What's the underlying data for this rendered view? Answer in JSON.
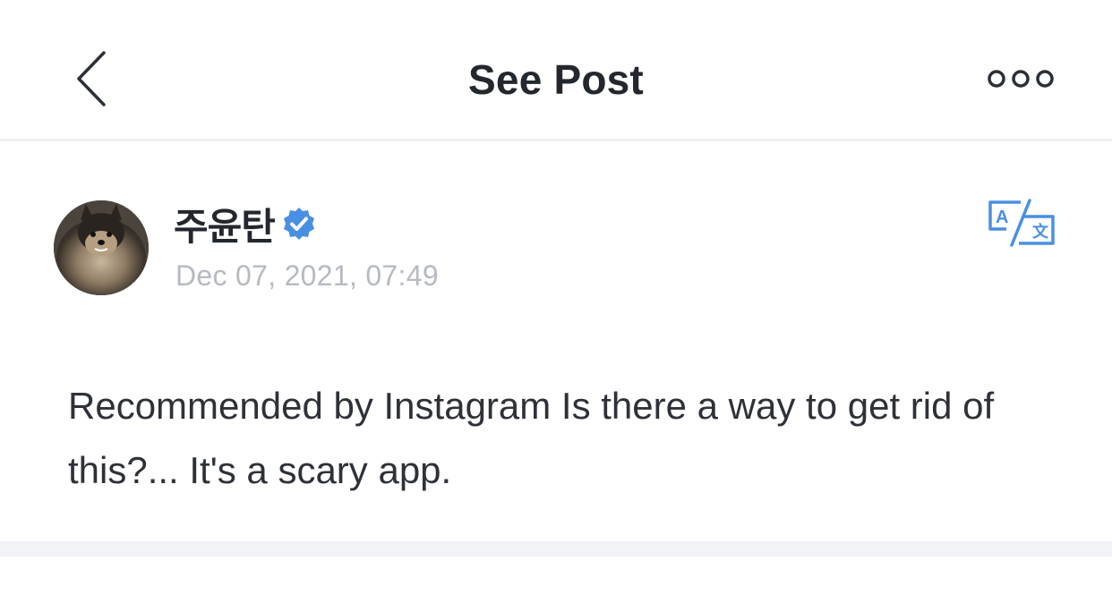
{
  "navbar": {
    "title": "See Post",
    "back_icon": "chevron-left-icon",
    "more_icon": "more-horizontal-icon"
  },
  "post": {
    "author_name": "주윤탄",
    "verified": true,
    "date": "Dec 07, 2021, 07:49",
    "body": "Recommended by Instagram Is there a way to get rid of this?... It's a scary app.",
    "translate_icon": "translate-icon",
    "avatar_icon": "dog-avatar"
  },
  "colors": {
    "accent": "#4a90e2",
    "title_text": "#23272e",
    "body_text": "#2e3238",
    "date_text": "#b6bac1",
    "separator": "#f2f3f7"
  }
}
